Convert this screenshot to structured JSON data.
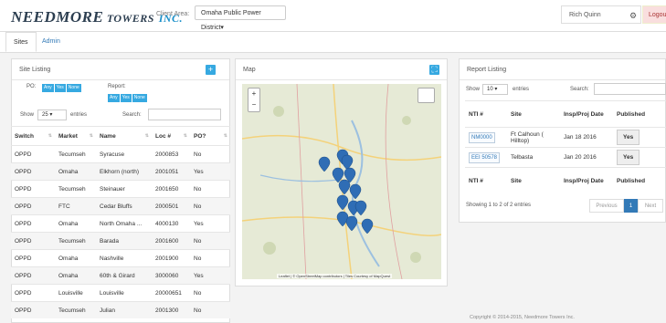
{
  "header": {
    "logo_main": "NEEDMORE",
    "logo_towers": "TOWERS",
    "logo_inc": "INC.",
    "client_area_label": "Client Area:",
    "client_area_value": "Omaha Public Power District",
    "user_name": "Rich Quinn",
    "logout_label": "Logou"
  },
  "tabs": [
    {
      "label": "Sites"
    },
    {
      "label": "Admin"
    }
  ],
  "site_listing": {
    "title": "Site Listing",
    "po_label": "PO:",
    "po_options": [
      "Any",
      "Yes",
      "None"
    ],
    "report_label": "Report:",
    "report_options": [
      "Any",
      "Yes",
      "None"
    ],
    "show_label": "Show",
    "show_value": "25",
    "entries_label": "entries",
    "search_label": "Search:",
    "columns": [
      "Switch",
      "Market",
      "Name",
      "Loc #",
      "PO?"
    ],
    "rows": [
      [
        "OPPD",
        "Tecumseh",
        "Syracuse",
        "2000853",
        "No"
      ],
      [
        "OPPD",
        "Omaha",
        "Elkhorn (north)",
        "2001051",
        "Yes"
      ],
      [
        "OPPD",
        "Tecumseh",
        "Steinauer",
        "2001650",
        "No"
      ],
      [
        "OPPD",
        "FTC",
        "Cedar Bluffs",
        "2000501",
        "No"
      ],
      [
        "OPPD",
        "Omaha",
        "North Omaha ...",
        "4000130",
        "Yes"
      ],
      [
        "OPPD",
        "Tecumseh",
        "Barada",
        "2001600",
        "No"
      ],
      [
        "OPPD",
        "Omaha",
        "Nashville",
        "2001900",
        "No"
      ],
      [
        "OPPD",
        "Omaha",
        "60th & Girard",
        "3000060",
        "Yes"
      ],
      [
        "OPPD",
        "Louisville",
        "Louisville",
        "20000651",
        "No"
      ],
      [
        "OPPD",
        "Tecumseh",
        "Julian",
        "2001300",
        "No"
      ]
    ]
  },
  "map": {
    "title": "Map",
    "zoom_in": "+",
    "zoom_out": "−",
    "attribution": "Leaflet | © OpenStreetMap contributors | Tiles Courtesy of MapQuest"
  },
  "report_listing": {
    "title": "Report Listing",
    "show_label": "Show",
    "show_value": "10",
    "entries_label": "entries",
    "search_label": "Search:",
    "columns": [
      "NTI #",
      "Site",
      "Insp/Proj Date",
      "Published"
    ],
    "rows": [
      {
        "nti": "NM0000",
        "site": "Ft Calhoun ( Hilltop)",
        "date": "Jan 18 2016",
        "published": "Yes"
      },
      {
        "nti": "EEI 50578",
        "site": "Telbasta",
        "date": "Jan 20 2016",
        "published": "Yes"
      }
    ],
    "footer_columns": [
      "NTI #",
      "Site",
      "Insp/Proj Date",
      "Published"
    ],
    "summary": "Showing 1 to 2 of 2 entries",
    "previous": "Previous",
    "page": "1",
    "next": "Next"
  },
  "footer": {
    "copyright": "Copyright © 2014-2015, Needmore Towers Inc."
  },
  "colors": {
    "accent": "#36a9e1",
    "marker": "#2f6db5",
    "logo": "#2c3e50"
  }
}
